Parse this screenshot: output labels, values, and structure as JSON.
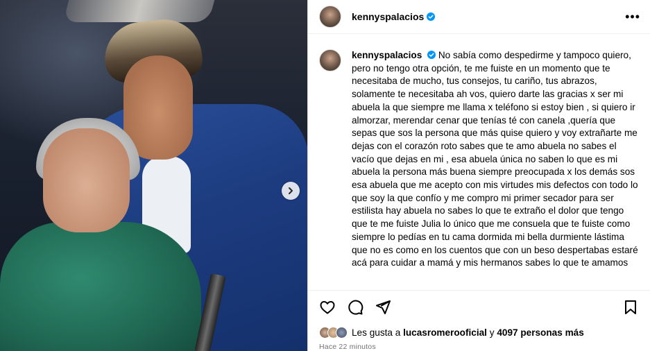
{
  "post": {
    "username": "kennyspalacios",
    "verified": true,
    "caption": "No sabía como despedirme y tampoco quiero, pero no tengo otra opción, te me fuiste en un momento que te necesitaba de mucho, tus consejos, tu cariño, tus abrazos, solamente te necesitaba ah vos, quiero darte las gracias x ser mi abuela la que siempre me llama x teléfono si estoy bien , si quiero ir almorzar, merendar cenar que tenías té con canela ,quería que sepas que sos la persona que más quise quiero y voy extrañarte me dejas con el corazón roto sabes que te amo abuela no sabes el vacío que dejas en mi , esa abuela única no saben lo que es mi abuela la persona más buena siempre preocupada x los demás sos esa abuela que me acepto con mis virtudes mis defectos con todo lo que soy la que confío y me compro mi primer secador para ser estilista hay abuela no sabes lo que te extraño el dolor que tengo que te me fuiste Julia lo único que me consuela que te fuiste como siempre lo pedías en tu cama dormida mi bella durmiente lástima que no es como en los cuentos que con un beso despertabas estaré acá para cuidar a mamá y mis hermanos sabes lo que te amamos",
    "likes_prefix": "Les gusta a",
    "likes_user": "lucasromerooficial",
    "likes_and": "y",
    "likes_count": "4097 personas más",
    "time_ago": "Hace 22 minutos"
  },
  "icons": {
    "verified": "verified-badge-icon",
    "more": "more-options-icon",
    "like": "heart-icon",
    "comment": "comment-icon",
    "share": "send-icon",
    "save": "bookmark-icon",
    "next": "chevron-right-icon"
  },
  "colors": {
    "verified": "#0095f6",
    "muted": "#737373",
    "divider": "#dbdbdb"
  }
}
